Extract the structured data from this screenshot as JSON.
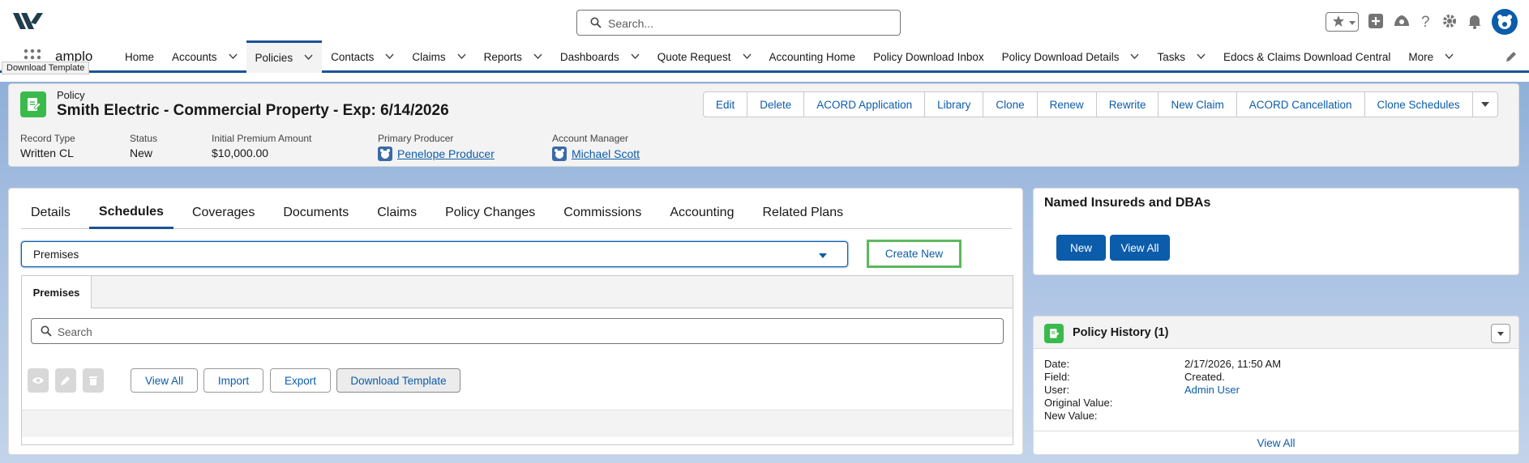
{
  "header": {
    "search_placeholder": "Search..."
  },
  "nav": {
    "app_name": "amplo",
    "tooltip": "Download Template",
    "items": [
      {
        "label": "Home",
        "dropdown": false
      },
      {
        "label": "Accounts",
        "dropdown": true
      },
      {
        "label": "Policies",
        "dropdown": true,
        "active": true
      },
      {
        "label": "Contacts",
        "dropdown": true
      },
      {
        "label": "Claims",
        "dropdown": true
      },
      {
        "label": "Reports",
        "dropdown": true
      },
      {
        "label": "Dashboards",
        "dropdown": true
      },
      {
        "label": "Quote Request",
        "dropdown": true
      },
      {
        "label": "Accounting Home",
        "dropdown": false
      },
      {
        "label": "Policy Download Inbox",
        "dropdown": false
      },
      {
        "label": "Policy Download Details",
        "dropdown": true
      },
      {
        "label": "Tasks",
        "dropdown": true
      },
      {
        "label": "Edocs & Claims Download Central",
        "dropdown": false
      },
      {
        "label": "More",
        "dropdown": true
      }
    ]
  },
  "record": {
    "object_type": "Policy",
    "title": "Smith Electric - Commercial Property - Exp: 6/14/2026",
    "actions": [
      "Edit",
      "Delete",
      "ACORD Application",
      "Library",
      "Clone",
      "Renew",
      "Rewrite",
      "New Claim",
      "ACORD Cancellation",
      "Clone Schedules"
    ],
    "fields": {
      "record_type_label": "Record Type",
      "record_type_value": "Written CL",
      "status_label": "Status",
      "status_value": "New",
      "premium_label": "Initial Premium Amount",
      "premium_value": "$10,000.00",
      "producer_label": "Primary Producer",
      "producer_value": "Penelope Producer",
      "manager_label": "Account Manager",
      "manager_value": "Michael Scott"
    }
  },
  "main": {
    "tabs": [
      "Details",
      "Schedules",
      "Coverages",
      "Documents",
      "Claims",
      "Policy Changes",
      "Commissions",
      "Accounting",
      "Related Plans"
    ],
    "active_tab": "Schedules",
    "schedule_select": "Premises",
    "create_new_label": "Create New",
    "subtab_label": "Premises",
    "search_placeholder": "Search",
    "toolbar": {
      "view_all": "View All",
      "import": "Import",
      "export": "Export",
      "download_template": "Download Template"
    }
  },
  "named_insureds": {
    "title": "Named Insureds and DBAs",
    "new_label": "New",
    "view_all_label": "View All"
  },
  "policy_history": {
    "title": "Policy History (1)",
    "rows": [
      {
        "label": "Date:",
        "value": "2/17/2026, 11:50 AM"
      },
      {
        "label": "Field:",
        "value": "Created."
      },
      {
        "label": "User:",
        "value": "Admin User"
      },
      {
        "label": "Original Value:",
        "value": ""
      },
      {
        "label": "New Value:",
        "value": ""
      }
    ],
    "view_all_label": "View All"
  },
  "colors": {
    "brand": "#0b5cab",
    "nav_accent": "#1b5297",
    "record_icon": "#3bba4c",
    "highlight_outline": "#5cb85c"
  }
}
